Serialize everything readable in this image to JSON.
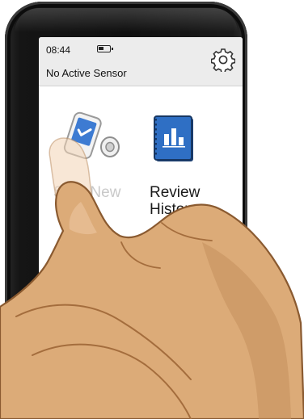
{
  "status_bar": {
    "time": "08:44",
    "battery_icon": "battery-icon",
    "sensor_status": "No Active Sensor",
    "settings_icon": "gear-icon"
  },
  "home": {
    "start_tile": {
      "label": "Start New",
      "icon": "reader-with-sensor-icon"
    },
    "review_tile": {
      "label": "Review\nHistory",
      "icon": "history-book-chart-icon"
    }
  },
  "colors": {
    "device_body": "#111111",
    "status_bar_bg": "#ececec",
    "tile_icon_blue": "#2f6fc4",
    "skin": "#dcab78"
  }
}
